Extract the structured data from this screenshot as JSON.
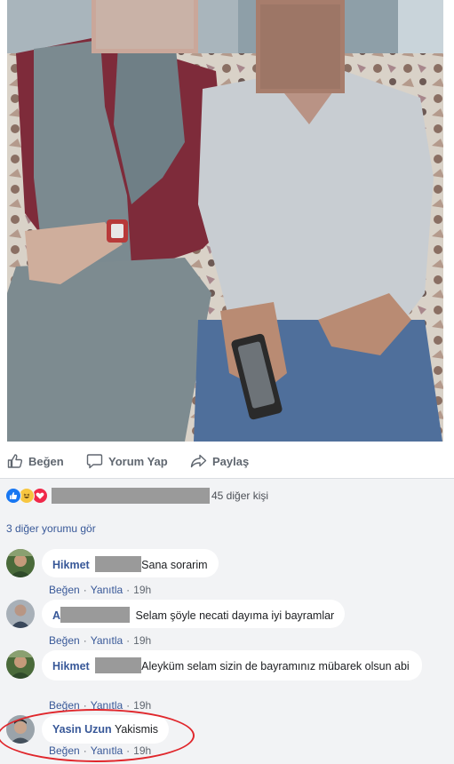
{
  "actions": {
    "like": "Beğen",
    "comment": "Yorum Yap",
    "share": "Paylaş"
  },
  "reactions": {
    "count_text": "45 diğer kişi",
    "icons": [
      "like-icon",
      "haha-icon",
      "love-icon"
    ]
  },
  "more_comments": "3 diğer yorumu gör",
  "comments": [
    {
      "author": "Hikmet",
      "text": "Sana sorarim",
      "like": "Beğen",
      "reply": "Yanıtla",
      "time": "19h"
    },
    {
      "author": "A",
      "text": "Selam şöyle necati dayıma iyi bayramlar",
      "like": "Beğen",
      "reply": "Yanıtla",
      "time": "19h"
    },
    {
      "author": "Hikmet",
      "text": "Aleyküm selam sizin de bayramınız mübarek olsun abi",
      "like": "Beğen",
      "reply": "Yanıtla",
      "time": "19h"
    },
    {
      "author": "Yasin Uzun",
      "text": "Yakismis",
      "like": "Beğen",
      "reply": "Yanıtla",
      "time": "19h"
    }
  ],
  "colors": {
    "link": "#385898",
    "highlight_circle": "#e0262b",
    "feedback_bg": "#f2f3f5"
  }
}
